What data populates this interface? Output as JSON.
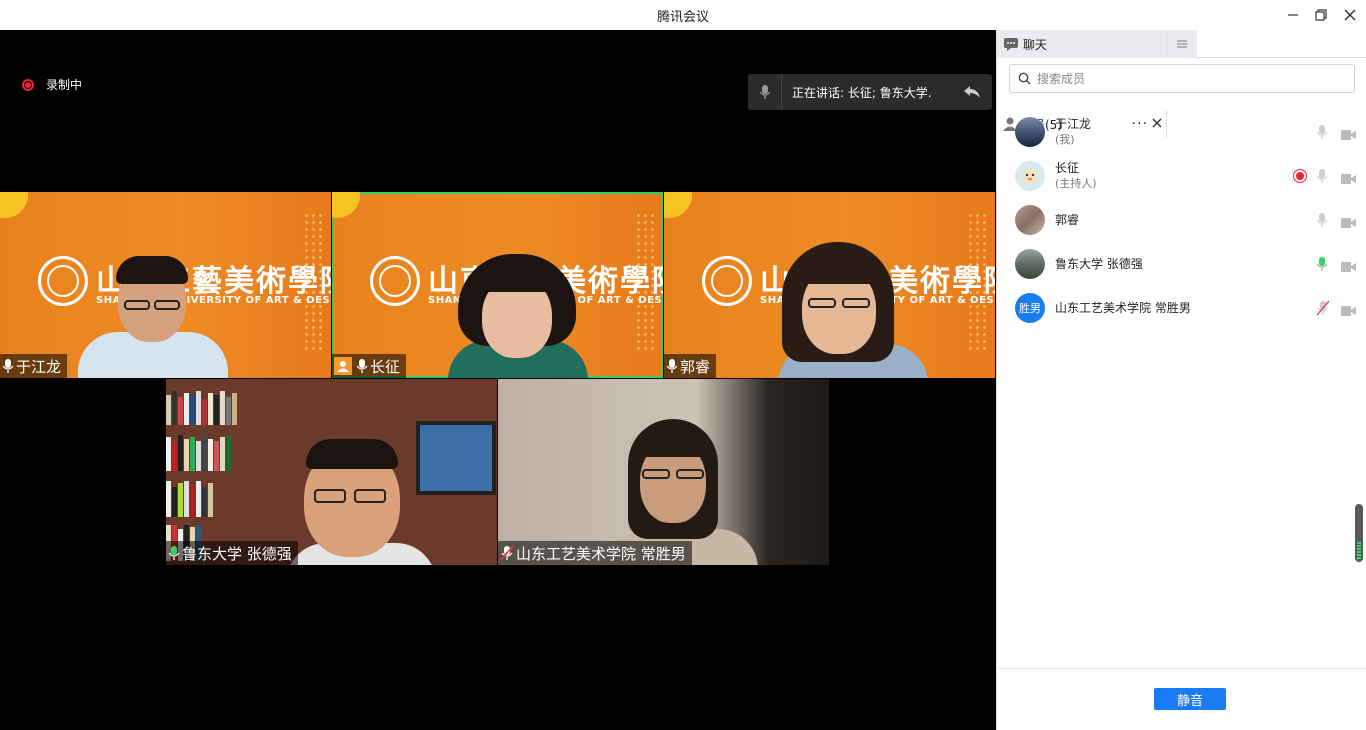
{
  "window": {
    "title": "腾讯会议"
  },
  "recording": {
    "label": "录制中"
  },
  "speaking": {
    "text": "正在讲话: 长征; 鲁东大学..."
  },
  "banner": {
    "school_cn": "山東工藝美術學院",
    "school_en": "SHANDONG UNIVERSITY OF ART & DESIGN"
  },
  "tiles": [
    {
      "name": "于江龙",
      "mic": "on"
    },
    {
      "name": "长征",
      "mic": "on",
      "host": true,
      "speaking": true
    },
    {
      "name": "郭睿",
      "mic": "on"
    },
    {
      "name": "鲁东大学 张德强",
      "mic": "active"
    },
    {
      "name": "山东工艺美术学院 常胜男",
      "mic": "muted"
    }
  ],
  "panel": {
    "tab_chat": "聊天",
    "tab_members": "成员(5)",
    "search_placeholder": "搜索成员",
    "mute_all": "静音",
    "members": [
      {
        "name": "于江龙",
        "sub": "(我)",
        "mic": "off"
      },
      {
        "name": "长征",
        "sub": "(主持人)",
        "mic": "off",
        "recording": true
      },
      {
        "name": "郭睿",
        "sub": "",
        "mic": "off"
      },
      {
        "name": "鲁东大学 张德强",
        "sub": "",
        "mic": "active"
      },
      {
        "name": "山东工艺美术学院 常胜男",
        "sub": "",
        "mic": "muted",
        "avatar_text": "胜男"
      }
    ]
  },
  "colors": {
    "accent": "#1a7cf2",
    "banner": "#ec8622",
    "speaking_border": "#2fd06a",
    "record": "#e22233"
  },
  "icons": [
    "minimize-icon",
    "restore-icon",
    "close-icon",
    "mic-icon",
    "camera-icon",
    "search-icon",
    "chat-icon",
    "user-icon",
    "menu-icon",
    "record-icon",
    "back-icon"
  ]
}
